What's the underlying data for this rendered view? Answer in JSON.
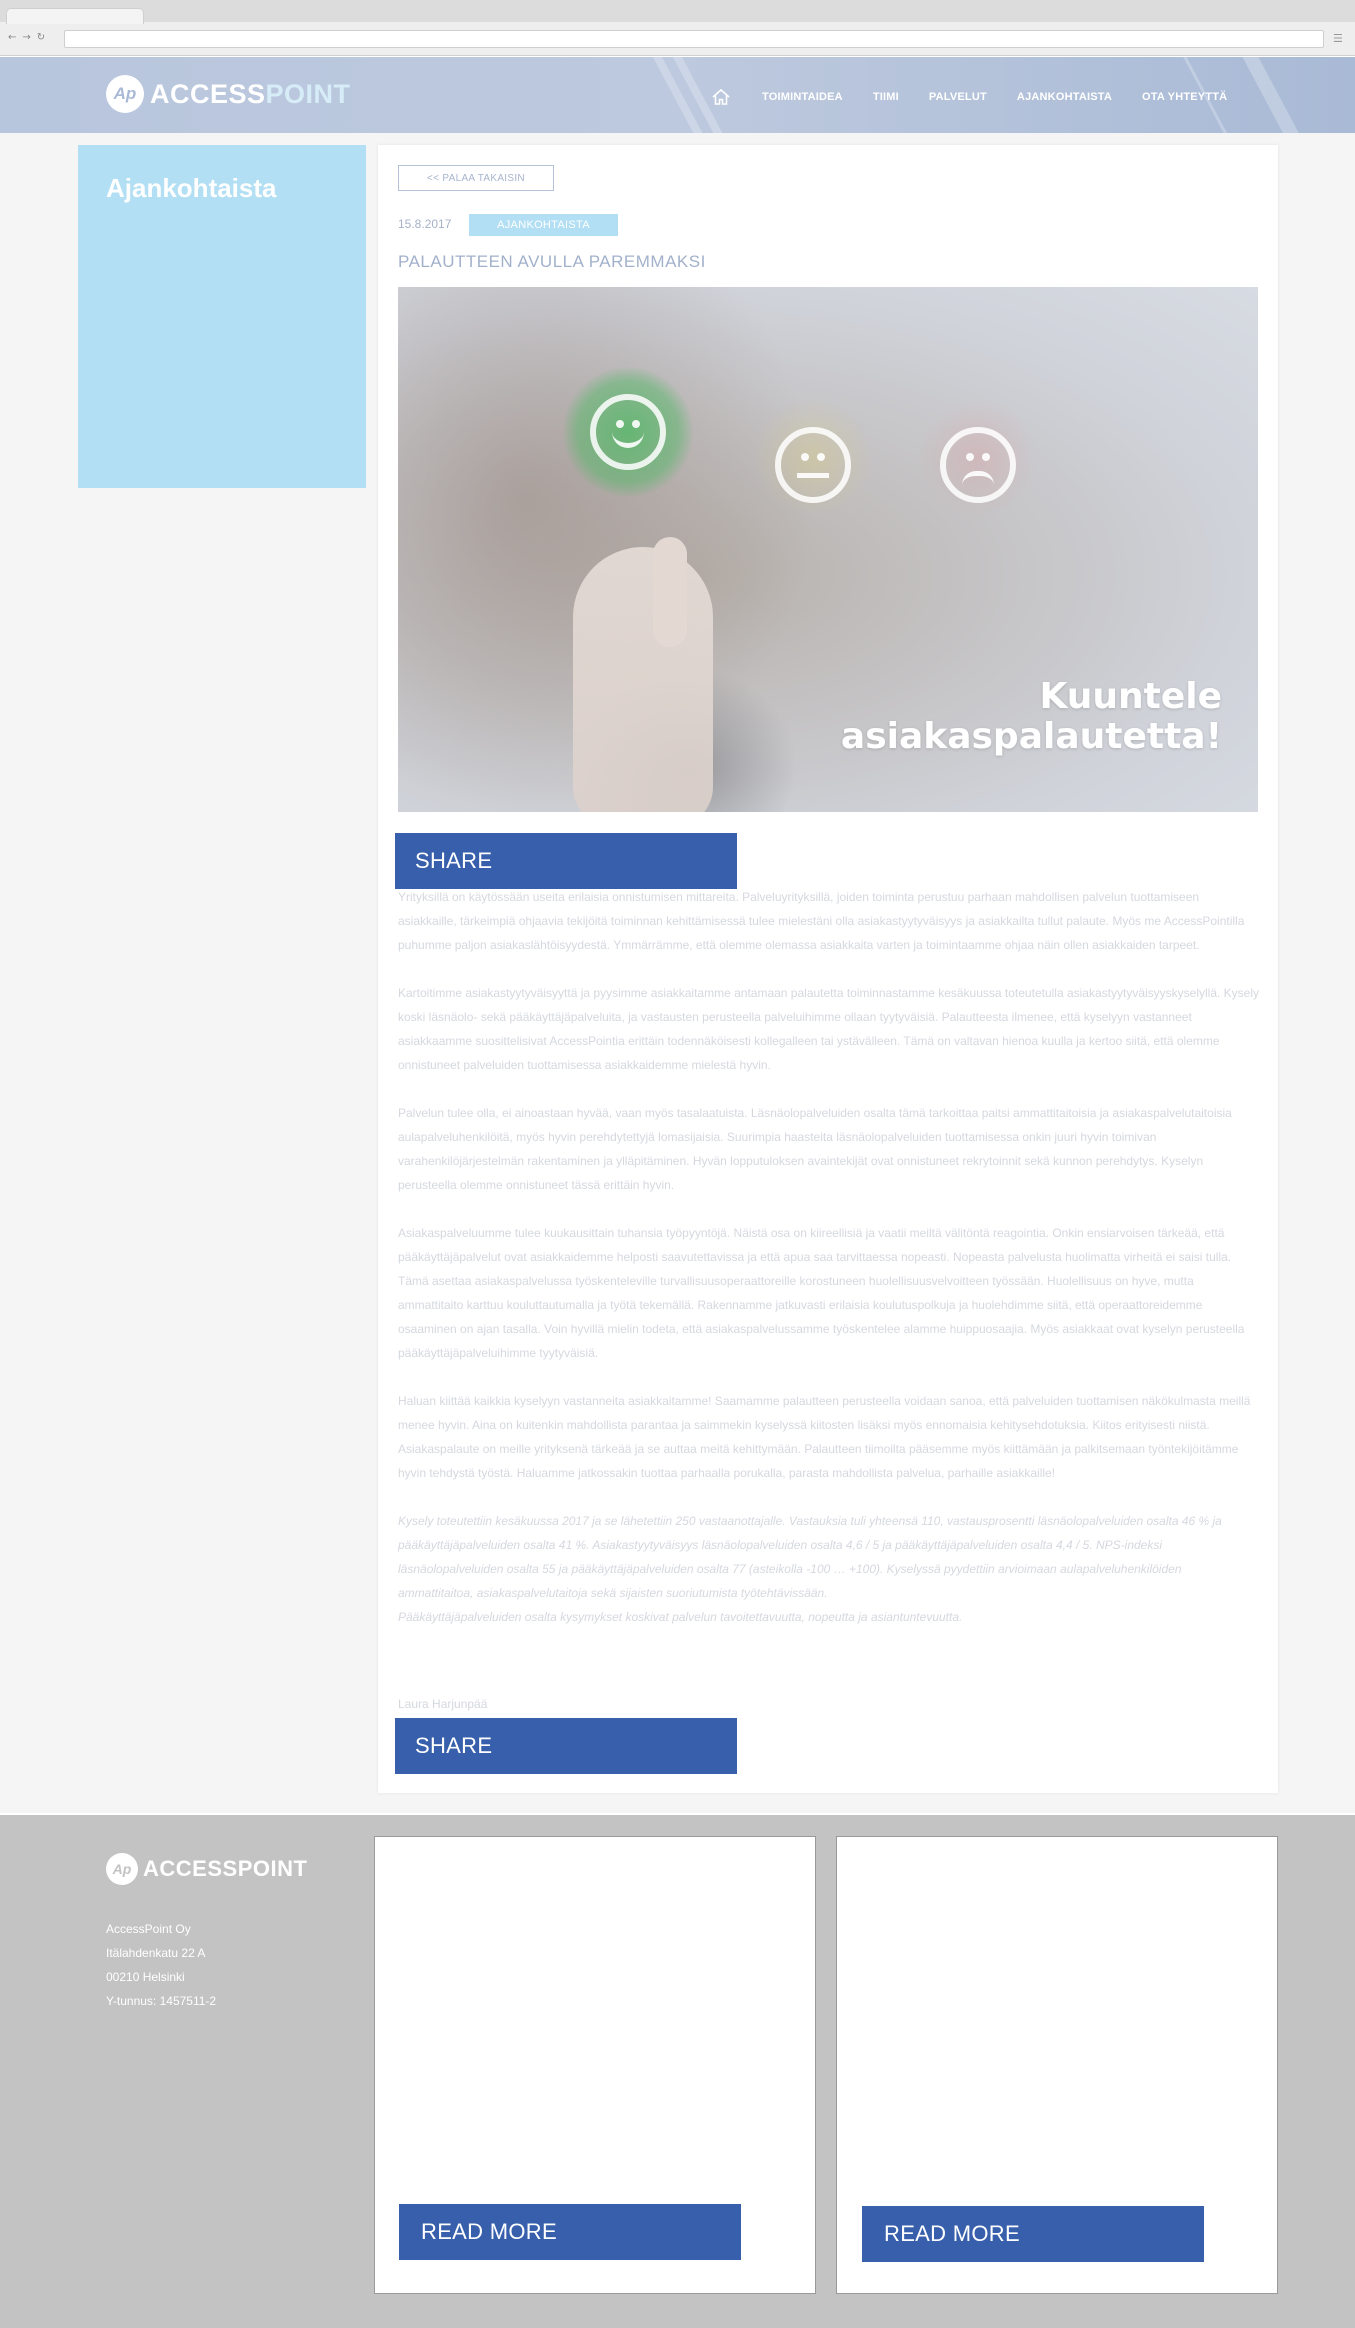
{
  "header": {
    "logo_text_a": "ACCESS",
    "logo_text_b": "POINT",
    "logo_mark": "Ap",
    "home_icon": "home-icon",
    "nav": [
      {
        "label": "TOIMINTAIDEA"
      },
      {
        "label": "TIIMI"
      },
      {
        "label": "PALVELUT"
      },
      {
        "label": "AJANKOHTAISTA"
      },
      {
        "label": "OTA YHTEYTTÄ"
      }
    ]
  },
  "sidebar": {
    "title": "Ajankohtaista"
  },
  "article": {
    "back_label": "<< PALAA TAKAISIN",
    "date": "15.8.2017",
    "category": "AJANKOHTAISTA",
    "title": "PALAUTTEEN AVULLA PAREMMAKSI",
    "hero_caption_line1": "Kuuntele",
    "hero_caption_line2": "asiakaspalautetta!",
    "share_label": "SHARE",
    "paragraphs": [
      "Yrityksillä on käytössään useita erilaisia onnistumisen mittareita. Palveluyrityksillä, joiden toiminta perustuu parhaan mahdollisen palvelun tuottamiseen asiakkaille, tärkeimpiä ohjaavia tekijöitä toiminnan kehittämisessä tulee mielestäni olla asiakastyytyväisyys ja asiakkailta tullut palaute. Myös me AccessPointilla puhumme paljon asiakaslähtöisyydestä. Ymmärrämme, että olemme olemassa asiakkaita varten ja toimintaamme ohjaa näin ollen asiakkaiden tarpeet.",
      "Kartoitimme asiakastyytyväisyyttä ja pyysimme asiakkaitamme antamaan palautetta toiminnastamme kesäkuussa toteutetulla asiakastyytyväisyyskyselyllä. Kysely koski läsnäolo- sekä pääkäyttäjäpalveluita, ja vastausten perusteella palveluihimme ollaan tyytyväisiä. Palautteesta ilmenee, että kyselyyn vastanneet asiakkaamme suosittelisivat AccessPointia erittäin todennäköisesti kollegalleen tai ystävälleen. Tämä on valtavan hienoa kuulla ja kertoo siitä, että olemme onnistuneet palveluiden tuottamisessa asiakkaidemme mielestä hyvin.",
      "Palvelun tulee olla, ei ainoastaan hyvää, vaan myös tasalaatuista. Läsnäolopalveluiden osalta tämä tarkoittaa paitsi ammattitaitoisia ja asiakaspalvelutaitoisia aulapalveluhenkilöitä, myös hyvin perehdytettyjä lomasijaisia. Suurimpia haasteita läsnäolopalveluiden tuottamisessa onkin juuri hyvin toimivan varahenkilöjärjestelmän rakentaminen ja ylläpitäminen. Hyvän lopputuloksen avaintekijät ovat onnistuneet rekrytoinnit sekä kunnon perehdytys. Kyselyn perusteella olemme onnistuneet tässä erittäin hyvin.",
      "Asiakaspalveluumme tulee kuukausittain tuhansia työpyyntöjä. Näistä osa on kiireellisiä ja vaatii meiltä välitöntä reagointia. Onkin ensiarvoisen tärkeää, että pääkäyttäjäpalvelut ovat asiakkaidemme helposti saavutettavissa ja että apua saa tarvittaessa nopeasti. Nopeasta palvelusta huolimatta virheitä ei saisi tulla. Tämä asettaa asiakaspalvelussa työskenteleville turvallisuusoperaattoreille korostuneen huolellisuusvelvoitteen työssään. Huolellisuus on hyve, mutta ammattitaito karttuu kouluttautumalla ja työtä tekemällä. Rakennamme jatkuvasti erilaisia koulutuspolkuja ja huolehdimme siitä, että operaattoreidemme osaaminen on ajan tasalla. Voin hyvillä mielin todeta, että asiakaspalvelussamme työskentelee alamme huippuosaajia. Myös asiakkaat ovat kyselyn perusteella pääkäyttäjäpalveluihimme tyytyväisiä.",
      "Haluan kiittää kaikkia kyselyyn vastanneita asiakkaitamme! Saamamme palautteen perusteella voidaan sanoa, että palveluiden tuottamisen näkökulmasta meillä menee hyvin. Aina on kuitenkin mahdollista parantaa ja saimmekin kyselyssä kiitosten lisäksi myös ennomaisia kehitysehdotuksia. Kiitos erityisesti niistä. Asiakaspalaute on meille yrityksenä tärkeää ja se auttaa meitä kehittymään. Palautteen tiimoilta pääsemme myös kiittämään ja palkitsemaan työntekijöitämme hyvin tehdystä työstä. Haluamme jatkossakin tuottaa parhaalla porukalla, parasta mahdollista palvelua, parhaille asiakkaille!"
    ],
    "note": "Kysely toteutettiin kesäkuussa 2017 ja se lähetettiin 250 vastaanottajalle. Vastauksia tuli yhteensä 110, vastausprosentti läsnäolopalveluiden osalta 46 % ja pääkäyttäjäpalveluiden osalta 41 %. Asiakastyytyväisyys läsnäolopalveluiden osalta 4,6 / 5 ja pääkäyttäjäpalveluiden osalta 4,4 / 5. NPS-indeksi läsnäolopalveluiden osalta 55 ja pääkäyttäjäpalveluiden osalta 77 (asteikolla -100 … +100). Kyselyssä pyydettiin arvioimaan aulapalveluhenkilöiden ammattitaitoa, asiakaspalvelutaitoja sekä sijaisten suoriutumista työtehtävissään.",
    "note2": "Pääkäyttäjäpalveluiden osalta kysymykset koskivat palvelun tavoitettavuutta, nopeutta ja asiantuntevuutta.",
    "author": "Laura Harjunpää"
  },
  "footer": {
    "company": "AccessPoint Oy",
    "street": "Itälahdenkatu 22 A",
    "postal": "00210 Helsinki",
    "business_id": "Y-tunnus: 1457511-2",
    "read_more_label": "READ MORE"
  },
  "colors": {
    "header_bg": "#b8c6dd",
    "sidebar_bg": "#b3dff4",
    "button_blue": "#375fab",
    "footer_bg": "#c3c3c3",
    "smile_green": "#4bb860"
  }
}
